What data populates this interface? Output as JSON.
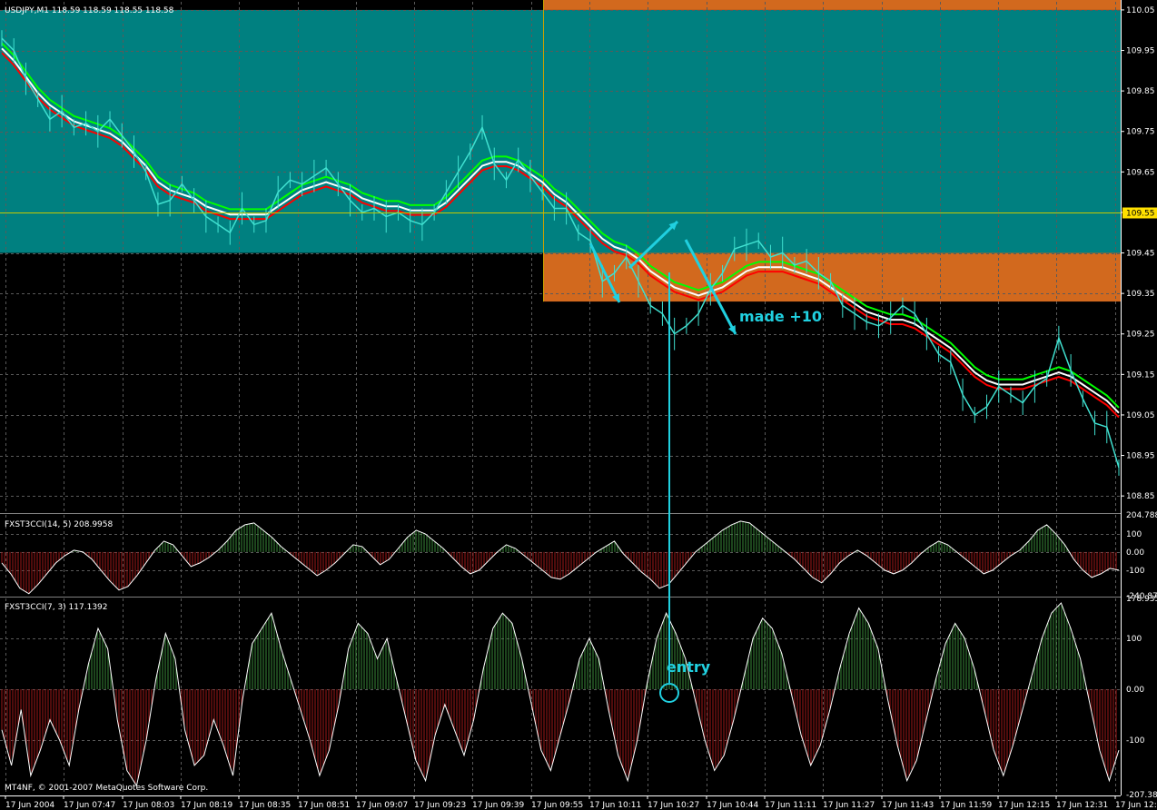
{
  "window": {
    "main_label": "USDJPY,M1  118.59 118.59 118.55 118.58",
    "cci1_label": "FXST3CCI(14, 5) 208.9958",
    "cci2_label": "FXST3CCI(7, 3) 117.1392",
    "copyright": "MT4NF, © 2001-2007 MetaQuotes Software Corp."
  },
  "colors": {
    "bg": "#000000",
    "teal_zone": "#008080",
    "orange_zone": "#D2691E",
    "grid": "#5A5A5A",
    "price": "#40E0D0",
    "ma_green": "#00FF00",
    "ma_white": "#FFFFFF",
    "ma_red": "#FF0000",
    "annotation": "#20D0E0",
    "cci_pos": "#3A8A3A",
    "cci_neg": "#A01818",
    "axis_text": "#FFFFFF",
    "current_price_bg": "#FFE000"
  },
  "annotations": {
    "made": "made +10",
    "entry": "entry"
  },
  "chart_data": [
    {
      "type": "line",
      "name": "price",
      "symbol": "USDJPY",
      "timeframe": "M1",
      "ylim": [
        108.81,
        110.07
      ],
      "y_ticks": [
        "110.05",
        "109.95",
        "109.85",
        "109.75",
        "109.65",
        "109.55",
        "109.45",
        "109.35",
        "109.25",
        "109.15",
        "109.05",
        "108.95",
        "108.85"
      ],
      "current_price": "109.55",
      "x_ticks": [
        "17 Jun 2004",
        "17 Jun 07:47",
        "17 Jun 08:03",
        "17 Jun 08:19",
        "17 Jun 08:35",
        "17 Jun 08:51",
        "17 Jun 09:07",
        "17 Jun 09:23",
        "17 Jun 09:39",
        "17 Jun 09:55",
        "17 Jun 10:11",
        "17 Jun 10:27",
        "17 Jun 10:44",
        "17 Jun 11:11",
        "17 Jun 11:27",
        "17 Jun 11:43",
        "17 Jun 11:59",
        "17 Jun 12:15",
        "17 Jun 12:31",
        "17 Jun 12:47"
      ],
      "zones": [
        {
          "color": "teal",
          "x_from": 0.0,
          "x_to": 1.0,
          "y_from": 109.45,
          "y_to": 110.05
        },
        {
          "color": "orange",
          "x_from": 0.485,
          "x_to": 1.0,
          "y_from": 110.05,
          "y_to": 110.09
        },
        {
          "color": "orange",
          "x_from": 0.485,
          "x_to": 1.0,
          "y_from": 109.33,
          "y_to": 109.45
        }
      ],
      "series": [
        {
          "name": "close",
          "values": [
            109.98,
            109.95,
            109.88,
            109.83,
            109.78,
            109.8,
            109.76,
            109.77,
            109.75,
            109.78,
            109.74,
            109.7,
            109.65,
            109.57,
            109.58,
            109.62,
            109.58,
            109.54,
            109.52,
            109.5,
            109.56,
            109.52,
            109.53,
            109.6,
            109.63,
            109.62,
            109.64,
            109.66,
            109.62,
            109.58,
            109.55,
            109.56,
            109.54,
            109.55,
            109.53,
            109.52,
            109.55,
            109.6,
            109.65,
            109.7,
            109.76,
            109.67,
            109.63,
            109.68,
            109.64,
            109.6,
            109.56,
            109.56,
            109.5,
            109.48,
            109.38,
            109.4,
            109.44,
            109.38,
            109.32,
            109.3,
            109.25,
            109.27,
            109.3,
            109.36,
            109.4,
            109.46,
            109.47,
            109.48,
            109.44,
            109.45,
            109.42,
            109.43,
            109.4,
            109.38,
            109.32,
            109.3,
            109.28,
            109.27,
            109.29,
            109.32,
            109.3,
            109.25,
            109.2,
            109.18,
            109.1,
            109.05,
            109.07,
            109.12,
            109.1,
            109.08,
            109.12,
            109.14,
            109.24,
            109.16,
            109.09,
            109.03,
            109.02,
            108.92
          ]
        },
        {
          "name": "ma_fast",
          "values": [
            109.95,
            109.92,
            109.88,
            109.84,
            109.81,
            109.79,
            109.77,
            109.76,
            109.75,
            109.74,
            109.72,
            109.69,
            109.66,
            109.62,
            109.6,
            109.59,
            109.58,
            109.56,
            109.55,
            109.54,
            109.54,
            109.54,
            109.54,
            109.56,
            109.58,
            109.6,
            109.61,
            109.62,
            109.61,
            109.6,
            109.58,
            109.57,
            109.56,
            109.56,
            109.55,
            109.55,
            109.55,
            109.57,
            109.6,
            109.63,
            109.66,
            109.67,
            109.67,
            109.66,
            109.64,
            109.62,
            109.59,
            109.57,
            109.54,
            109.51,
            109.48,
            109.46,
            109.45,
            109.43,
            109.4,
            109.38,
            109.36,
            109.35,
            109.34,
            109.35,
            109.36,
            109.38,
            109.4,
            109.41,
            109.41,
            109.41,
            109.4,
            109.39,
            109.38,
            109.36,
            109.34,
            109.32,
            109.3,
            109.29,
            109.28,
            109.28,
            109.27,
            109.25,
            109.23,
            109.21,
            109.18,
            109.15,
            109.13,
            109.12,
            109.12,
            109.12,
            109.13,
            109.14,
            109.15,
            109.14,
            109.12,
            109.1,
            109.08,
            109.05
          ]
        }
      ]
    },
    {
      "type": "area",
      "name": "FXST3CCI(14, 5)",
      "ylim": [
        -240.8721,
        204.7883
      ],
      "y_ticks": [
        "204.7883",
        "100",
        "0.00",
        "-100",
        "-240.8721"
      ],
      "values": [
        -60,
        -120,
        -200,
        -230,
        -180,
        -120,
        -60,
        -20,
        10,
        0,
        -40,
        -100,
        -160,
        -210,
        -190,
        -130,
        -60,
        10,
        60,
        40,
        -20,
        -80,
        -60,
        -30,
        10,
        60,
        120,
        150,
        160,
        120,
        80,
        30,
        -10,
        -50,
        -90,
        -130,
        -100,
        -60,
        -10,
        40,
        30,
        -20,
        -70,
        -40,
        20,
        80,
        120,
        100,
        60,
        20,
        -30,
        -80,
        -120,
        -100,
        -50,
        0,
        40,
        20,
        -20,
        -60,
        -100,
        -140,
        -150,
        -120,
        -80,
        -40,
        0,
        30,
        60,
        -10,
        -60,
        -110,
        -150,
        -200,
        -180,
        -120,
        -60,
        0,
        40,
        80,
        120,
        150,
        170,
        160,
        120,
        80,
        40,
        0,
        -40,
        -90,
        -140,
        -170,
        -120,
        -60,
        -20,
        10,
        -20,
        -60,
        -100,
        -120,
        -100,
        -60,
        -10,
        30,
        60,
        40,
        0,
        -40,
        -80,
        -120,
        -100,
        -60,
        -20,
        10,
        60,
        120,
        150,
        100,
        40,
        -40,
        -100,
        -140,
        -120,
        -90,
        -100
      ]
    },
    {
      "type": "area",
      "name": "FXST3CCI(7, 3)",
      "ylim": [
        -207.3821,
        178.9353
      ],
      "y_ticks": [
        "178.9353",
        "100",
        "0.00",
        "-100",
        "-207.3821"
      ],
      "values": [
        -80,
        -150,
        -40,
        -170,
        -120,
        -60,
        -100,
        -150,
        -40,
        50,
        120,
        80,
        -60,
        -160,
        -190,
        -100,
        20,
        110,
        60,
        -80,
        -150,
        -130,
        -60,
        -110,
        -170,
        -20,
        90,
        120,
        150,
        80,
        20,
        -40,
        -100,
        -170,
        -120,
        -30,
        80,
        130,
        110,
        60,
        100,
        20,
        -60,
        -140,
        -180,
        -90,
        -30,
        -80,
        -130,
        -60,
        40,
        120,
        150,
        130,
        60,
        -30,
        -120,
        -160,
        -90,
        -20,
        60,
        100,
        60,
        -40,
        -130,
        -180,
        -100,
        10,
        100,
        150,
        110,
        60,
        -20,
        -100,
        -160,
        -130,
        -60,
        20,
        100,
        140,
        120,
        70,
        -10,
        -90,
        -150,
        -110,
        -40,
        40,
        110,
        160,
        130,
        80,
        -20,
        -110,
        -180,
        -140,
        -60,
        20,
        90,
        130,
        100,
        40,
        -40,
        -120,
        -170,
        -110,
        -40,
        30,
        100,
        150,
        170,
        120,
        60,
        -30,
        -120,
        -180,
        -120
      ]
    }
  ]
}
